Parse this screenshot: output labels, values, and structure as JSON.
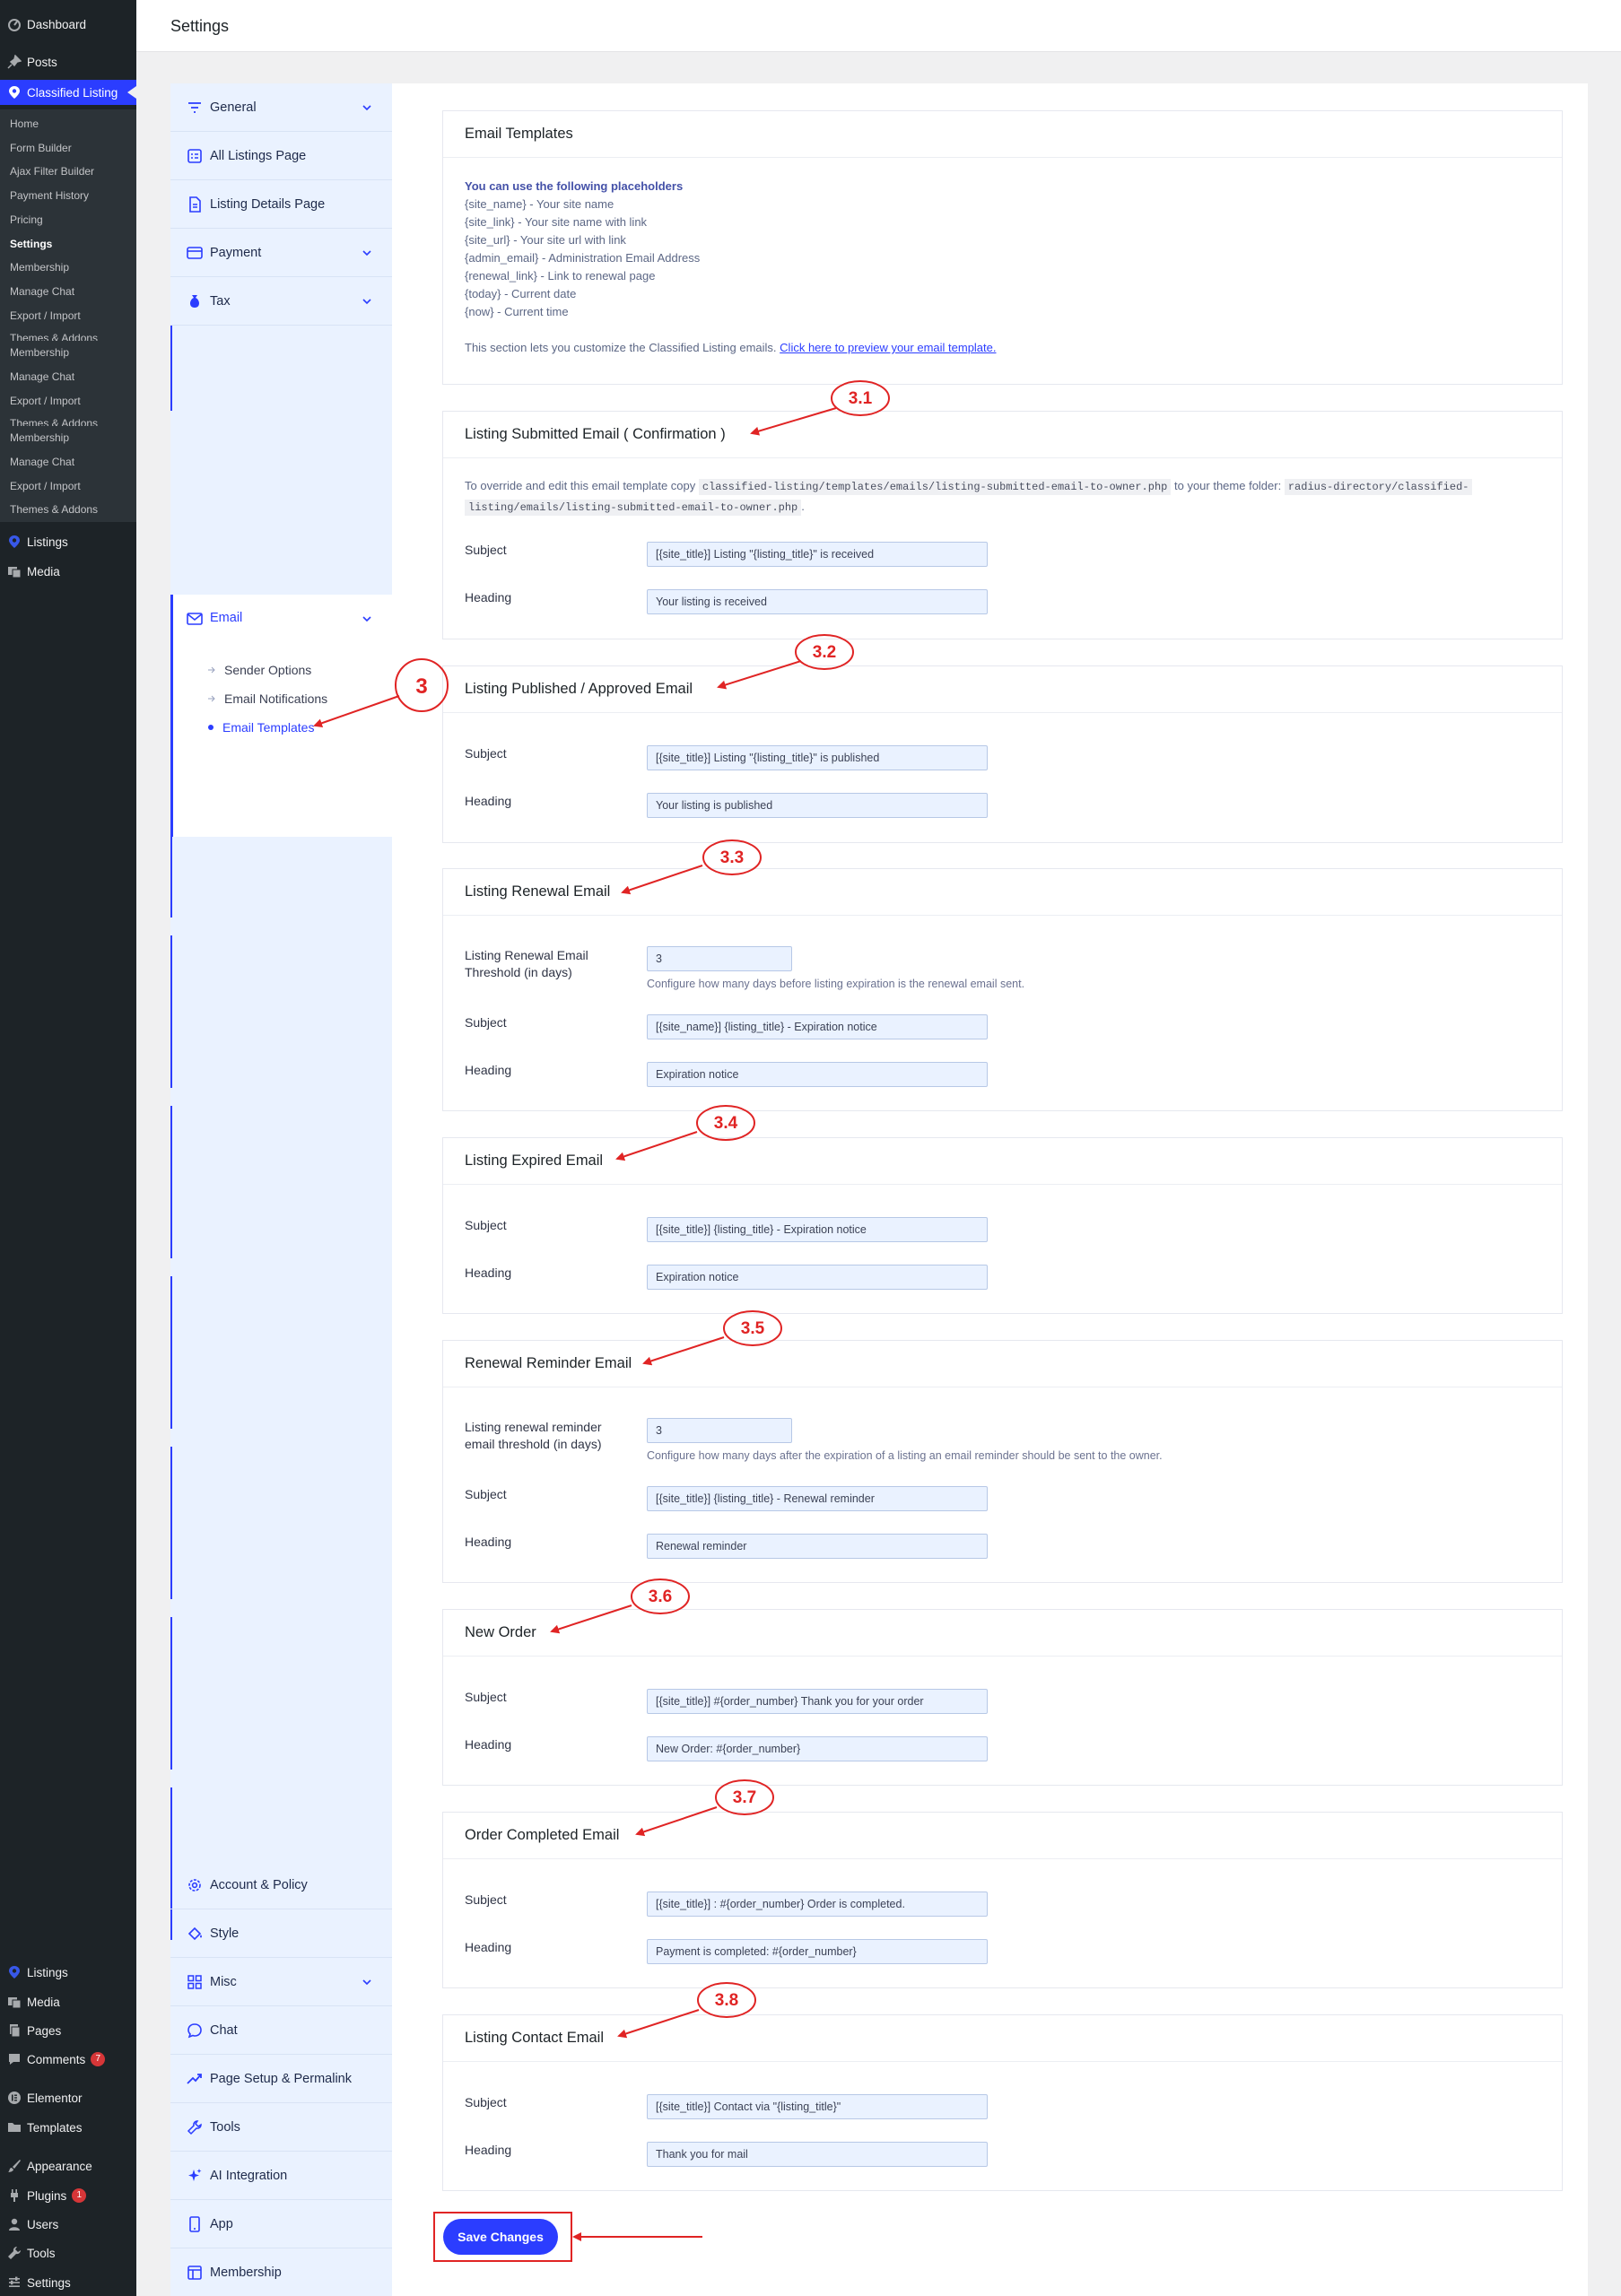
{
  "wp_menu": {
    "dashboard": "Dashboard",
    "posts": "Posts",
    "classified": "Classified Listing",
    "submenu": [
      "Home",
      "Form Builder",
      "Ajax Filter Builder",
      "Payment History",
      "Pricing",
      "Settings",
      "Membership",
      "Manage Chat",
      "Export / Import",
      "Themes & Addons",
      "Membership",
      "Manage Chat",
      "Export / Import",
      "Themes & Addons",
      "Membership",
      "Manage Chat",
      "Export / Import",
      "Themes & Addons"
    ],
    "listings": "Listings",
    "media": "Media",
    "bottom": [
      "Listings",
      "Media",
      "Pages",
      "Comments",
      "Elementor",
      "Templates",
      "Appearance",
      "Plugins",
      "Users",
      "Tools",
      "Settings"
    ],
    "comments_badge": "7",
    "plugins_badge": "1"
  },
  "header": {
    "title": "Settings"
  },
  "settings_nav": {
    "general": "General",
    "all_listings": "All Listings Page",
    "listing_details": "Listing Details Page",
    "payment": "Payment",
    "tax": "Tax",
    "email": "Email",
    "email_sub": [
      "Sender Options",
      "Email Notifications",
      "Email Templates"
    ],
    "account": "Account & Policy",
    "style": "Style",
    "misc": "Misc",
    "chat": "Chat",
    "page_setup": "Page Setup & Permalink",
    "tools": "Tools",
    "ai": "AI Integration",
    "app": "App",
    "membership": "Membership"
  },
  "templates": {
    "title": "Email Templates",
    "placeholder_heading": "You can use the following placeholders",
    "placeholders": [
      "{site_name} - Your site name",
      "{site_link} - Your site name with link",
      "{site_url} - Your site url with link",
      "{admin_email} - Administration Email Address",
      "{renewal_link} - Link to renewal page",
      "{today} - Current date",
      "{now} - Current time"
    ],
    "intro": "This section lets you customize the Classified Listing emails.",
    "preview_link": "Click here to preview your email template."
  },
  "labels": {
    "subject": "Subject",
    "heading": "Heading"
  },
  "sections": {
    "submitted": {
      "title": "Listing Submitted Email ( Confirmation )",
      "override_a": "To override and edit this email template copy",
      "path_a": "classified-listing/templates/emails/listing-submitted-email-to-owner.php",
      "override_b": "to your theme folder:",
      "path_b1": "radius-directory/classified-",
      "path_b2": "listing/emails/listing-submitted-email-to-owner.php",
      "subject": "[{site_title}] Listing \"{listing_title}\" is received",
      "heading": "Your listing is received"
    },
    "published": {
      "title": "Listing Published / Approved Email",
      "subject": "[{site_title}] Listing \"{listing_title}\" is published",
      "heading": "Your listing is published"
    },
    "renewal": {
      "title": "Listing Renewal Email",
      "threshold_label_1": "Listing Renewal Email",
      "threshold_label_2": "Threshold (in days)",
      "threshold": "3",
      "threshold_desc": "Configure how many days before listing expiration is the renewal email sent.",
      "subject": "[{site_name}] {listing_title} - Expiration notice",
      "heading": "Expiration notice"
    },
    "expired": {
      "title": "Listing Expired Email",
      "subject": "[{site_title}] {listing_title} - Expiration notice",
      "heading": "Expiration notice"
    },
    "reminder": {
      "title": "Renewal Reminder Email",
      "threshold_label_1": "Listing renewal reminder",
      "threshold_label_2": "email threshold (in days)",
      "threshold": "3",
      "threshold_desc": "Configure how many days after the expiration of a listing an email reminder should be sent to the owner.",
      "subject": "[{site_title}] {listing_title} - Renewal reminder",
      "heading": "Renewal reminder"
    },
    "new_order": {
      "title": "New Order",
      "subject": "[{site_title}] #{order_number} Thank you for your order",
      "heading": "New Order: #{order_number}"
    },
    "completed": {
      "title": "Order Completed Email",
      "subject": "[{site_title}] : #{order_number} Order is completed.",
      "heading": "Payment is completed: #{order_number}"
    },
    "contact": {
      "title": "Listing Contact Email",
      "subject": "[{site_title}] Contact via \"{listing_title}\"",
      "heading": "Thank you for mail"
    }
  },
  "annotations": [
    "3",
    "3.1",
    "3.2",
    "3.3",
    "3.4",
    "3.5",
    "3.6",
    "3.7",
    "3.8"
  ],
  "save_label": "Save Changes",
  "colors": {
    "accent": "#2b3dff",
    "annotation": "#e02424",
    "wp_sidebar": "#1d2327",
    "settings_nav_bg": "#eaf2ff"
  }
}
